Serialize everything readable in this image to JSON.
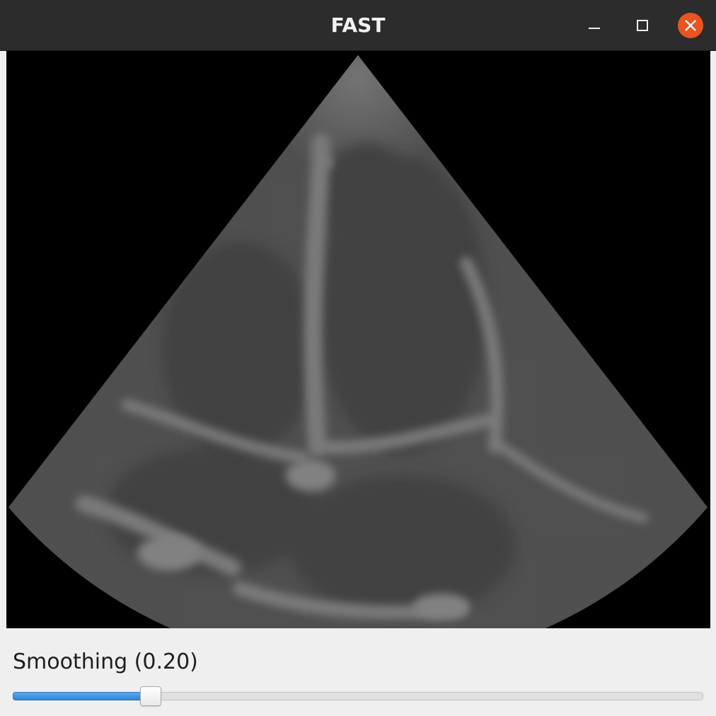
{
  "window": {
    "title": "FAST",
    "buttons": {
      "minimize_icon": "minimize-icon",
      "maximize_icon": "maximize-icon",
      "close_icon": "close-icon"
    },
    "colors": {
      "titlebar": "#2c2c2c",
      "close_button": "#e95420",
      "panel": "#efefef"
    }
  },
  "viewer": {
    "content": "ultrasound-sector-image",
    "background": "#000000"
  },
  "controls": {
    "smoothing": {
      "label": "Smoothing (0.20)",
      "value": 0.2,
      "min": 0,
      "max": 1,
      "accent": "#3d8fde"
    }
  }
}
